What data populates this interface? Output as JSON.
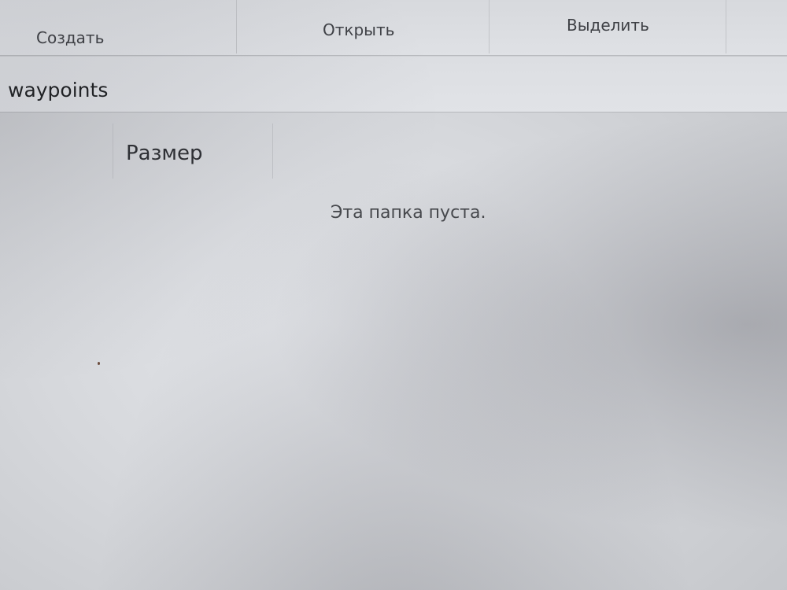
{
  "ribbon": {
    "create_label": "Создать",
    "open_label": "Открыть",
    "select_label": "Выделить"
  },
  "folder": {
    "title": "waypoints"
  },
  "columns": {
    "size_label": "Размер"
  },
  "content": {
    "empty_message": "Эта папка пуста."
  }
}
